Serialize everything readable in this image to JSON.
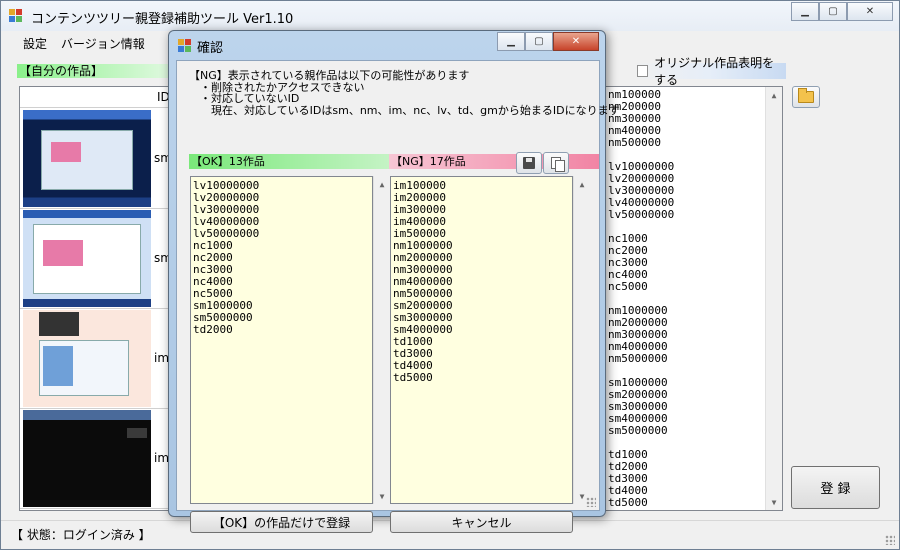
{
  "app": {
    "title": "コンテンツツリー親登録補助ツール Ver1.10",
    "menu": [
      "設定",
      "バージョン情報"
    ]
  },
  "main": {
    "own_works_label": "【自分の作品】",
    "original_checkbox_label": "オリジナル作品表明をする",
    "original_checked": false,
    "grid_header": "ID",
    "grid_rows": [
      "sm",
      "sm",
      "im",
      "im"
    ],
    "ids_text": "nm100000\nnm200000\nnm300000\nnm400000\nnm500000\n\nlv10000000\nlv20000000\nlv30000000\nlv40000000\nlv50000000\n\nnc1000\nnc2000\nnc3000\nnc4000\nnc5000\n\nnm1000000\nnm2000000\nnm3000000\nnm4000000\nnm5000000\n\nsm1000000\nsm2000000\nsm3000000\nsm4000000\nsm5000000\n\ntd1000\ntd2000\ntd3000\ntd4000\ntd5000",
    "register_label": "登 録"
  },
  "status": {
    "text": "【 状態：ログイン済み 】"
  },
  "dialog": {
    "title": "確認",
    "message": "【NG】表示されている親作品は以下の可能性があります\n　・削除されたかアクセスできない\n　・対応していないID\n　　現在、対応しているIDはsm、nm、im、nc、lv、td、gmから始まるIDになります",
    "ok_header": "【OK】13作品",
    "ng_header": "【NG】17作品",
    "ok_items": "lv10000000\nlv20000000\nlv30000000\nlv40000000\nlv50000000\nnc1000\nnc2000\nnc3000\nnc4000\nnc5000\nsm1000000\nsm5000000\ntd2000",
    "ng_items": "im100000\nim200000\nim300000\nim400000\nim500000\nnm1000000\nnm2000000\nnm3000000\nnm4000000\nnm5000000\nsm2000000\nsm3000000\nsm4000000\ntd1000\ntd3000\ntd4000\ntd5000",
    "register_ok_label": "【OK】の作品だけで登録",
    "cancel_label": "キャンセル"
  },
  "colors": {
    "ok_header": "#7ae87a",
    "ng_header": "#f184a4",
    "list_bg": "#ffffe0",
    "dialog_frame": "#a9c5e2"
  }
}
